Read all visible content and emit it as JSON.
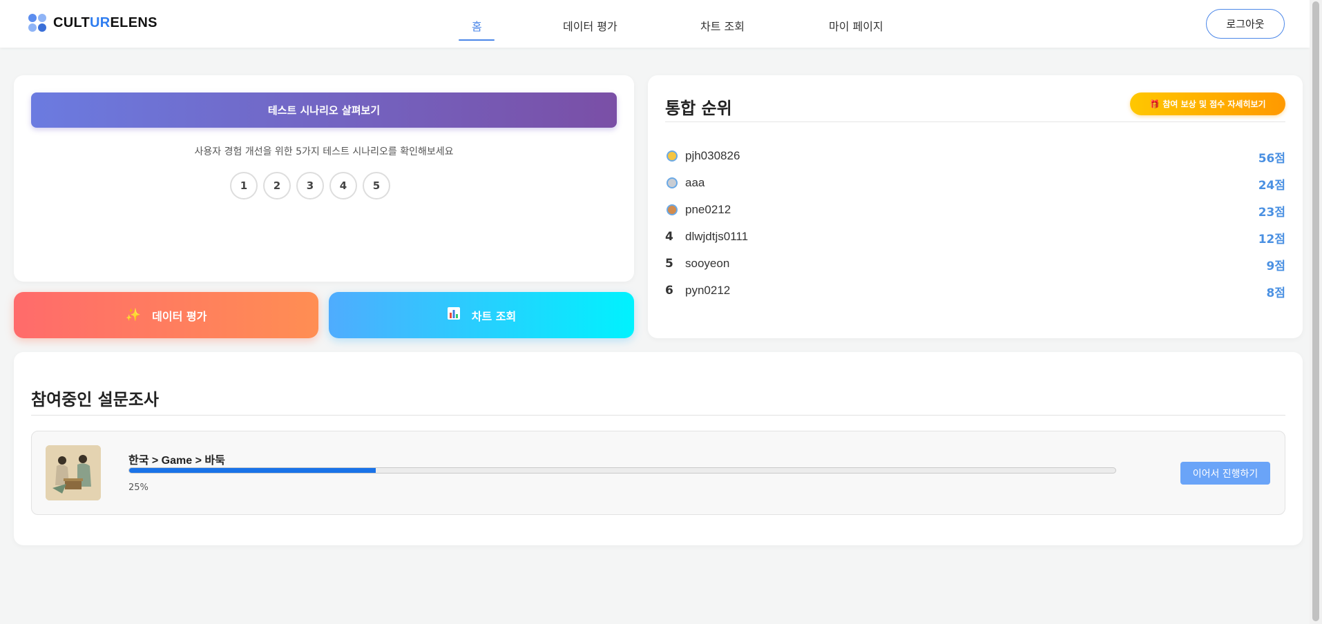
{
  "header": {
    "logo_prefix": "CULT",
    "logo_accent": "UR",
    "logo_suffix": "ELENS",
    "nav": [
      {
        "label": "홈",
        "active": true
      },
      {
        "label": "데이터 평가",
        "active": false
      },
      {
        "label": "차트 조회",
        "active": false
      },
      {
        "label": "마이 페이지",
        "active": false
      }
    ],
    "logout_label": "로그아웃"
  },
  "scenario": {
    "button_label": "테스트 시나리오 살펴보기",
    "description": "사용자 경험 개선을 위한 5가지 테스트 시나리오를 확인해보세요",
    "steps": [
      "1",
      "2",
      "3",
      "4",
      "5"
    ]
  },
  "actions": {
    "eval": {
      "icon": "sparkles-icon",
      "label": "데이터 평가"
    },
    "chart": {
      "icon": "bar-chart-icon",
      "label": "차트 조회"
    }
  },
  "ranking": {
    "title": "통합 순위",
    "reward_label": "참여 보상 및 점수 자세히보기",
    "rows": [
      {
        "rank": "1",
        "medal": "gold",
        "name": "pjh030826",
        "score": "56점"
      },
      {
        "rank": "2",
        "medal": "silver",
        "name": "aaa",
        "score": "24점"
      },
      {
        "rank": "3",
        "medal": "bronze",
        "name": "pne0212",
        "score": "23점"
      },
      {
        "rank": "4",
        "medal": "",
        "name": "dlwjdtjs0111",
        "score": "12점"
      },
      {
        "rank": "5",
        "medal": "",
        "name": "sooyeon",
        "score": "9점"
      },
      {
        "rank": "6",
        "medal": "",
        "name": "pyn0212",
        "score": "8점"
      }
    ]
  },
  "survey": {
    "title": "참여중인 설문조사",
    "items": [
      {
        "path": "한국 > Game > 바둑",
        "progress": 25,
        "progress_label": "25%",
        "button_label": "이어서 진행하기"
      }
    ]
  },
  "colors": {
    "accent": "#4a86e8",
    "score": "#4a90e2",
    "progress": "#1a73e8"
  }
}
